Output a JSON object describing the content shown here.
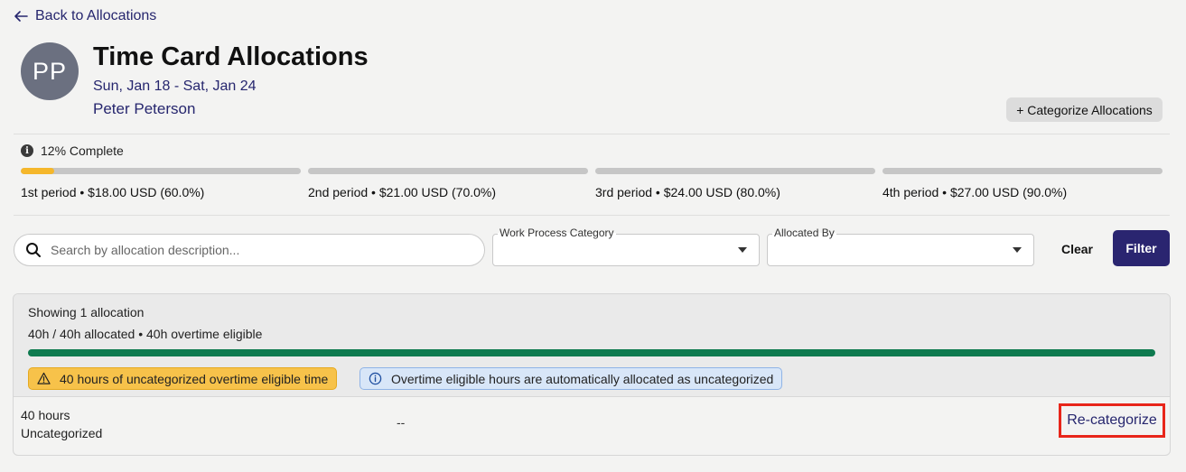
{
  "nav": {
    "back_label": "Back to Allocations"
  },
  "header": {
    "avatar_initials": "PP",
    "title": "Time Card Allocations",
    "date_range": "Sun, Jan 18 - Sat, Jan 24",
    "person_name": "Peter Peterson",
    "categorize_button": "+ Categorize Allocations"
  },
  "progress": {
    "label": "12% Complete",
    "accent_color": "#f5b72b",
    "periods": [
      {
        "label": "1st period • $18.00 USD (60.0%)",
        "fill_percent": 12
      },
      {
        "label": "2nd period • $21.00 USD (70.0%)",
        "fill_percent": 0
      },
      {
        "label": "3rd period • $24.00 USD (80.0%)",
        "fill_percent": 0
      },
      {
        "label": "4th period • $27.00 USD (90.0%)",
        "fill_percent": 0
      }
    ]
  },
  "filters": {
    "search_placeholder": "Search by allocation description...",
    "search_value": "",
    "work_process_label": "Work Process Category",
    "work_process_value": "",
    "allocated_by_label": "Allocated By",
    "allocated_by_value": "",
    "clear_label": "Clear",
    "filter_label": "Filter",
    "filter_color": "#2a2570"
  },
  "allocations": {
    "showing": "Showing 1 allocation",
    "summary": "40h / 40h allocated • 40h overtime eligible",
    "allocated_percent": 100,
    "bar_color": "#0e7a4f",
    "warning_badge": "40 hours of uncategorized overtime eligible time",
    "info_badge": "Overtime eligible hours are automatically allocated as uncategorized",
    "rows": [
      {
        "hours": "40 hours",
        "category": "Uncategorized",
        "detail": "--",
        "action": "Re-categorize"
      }
    ]
  }
}
